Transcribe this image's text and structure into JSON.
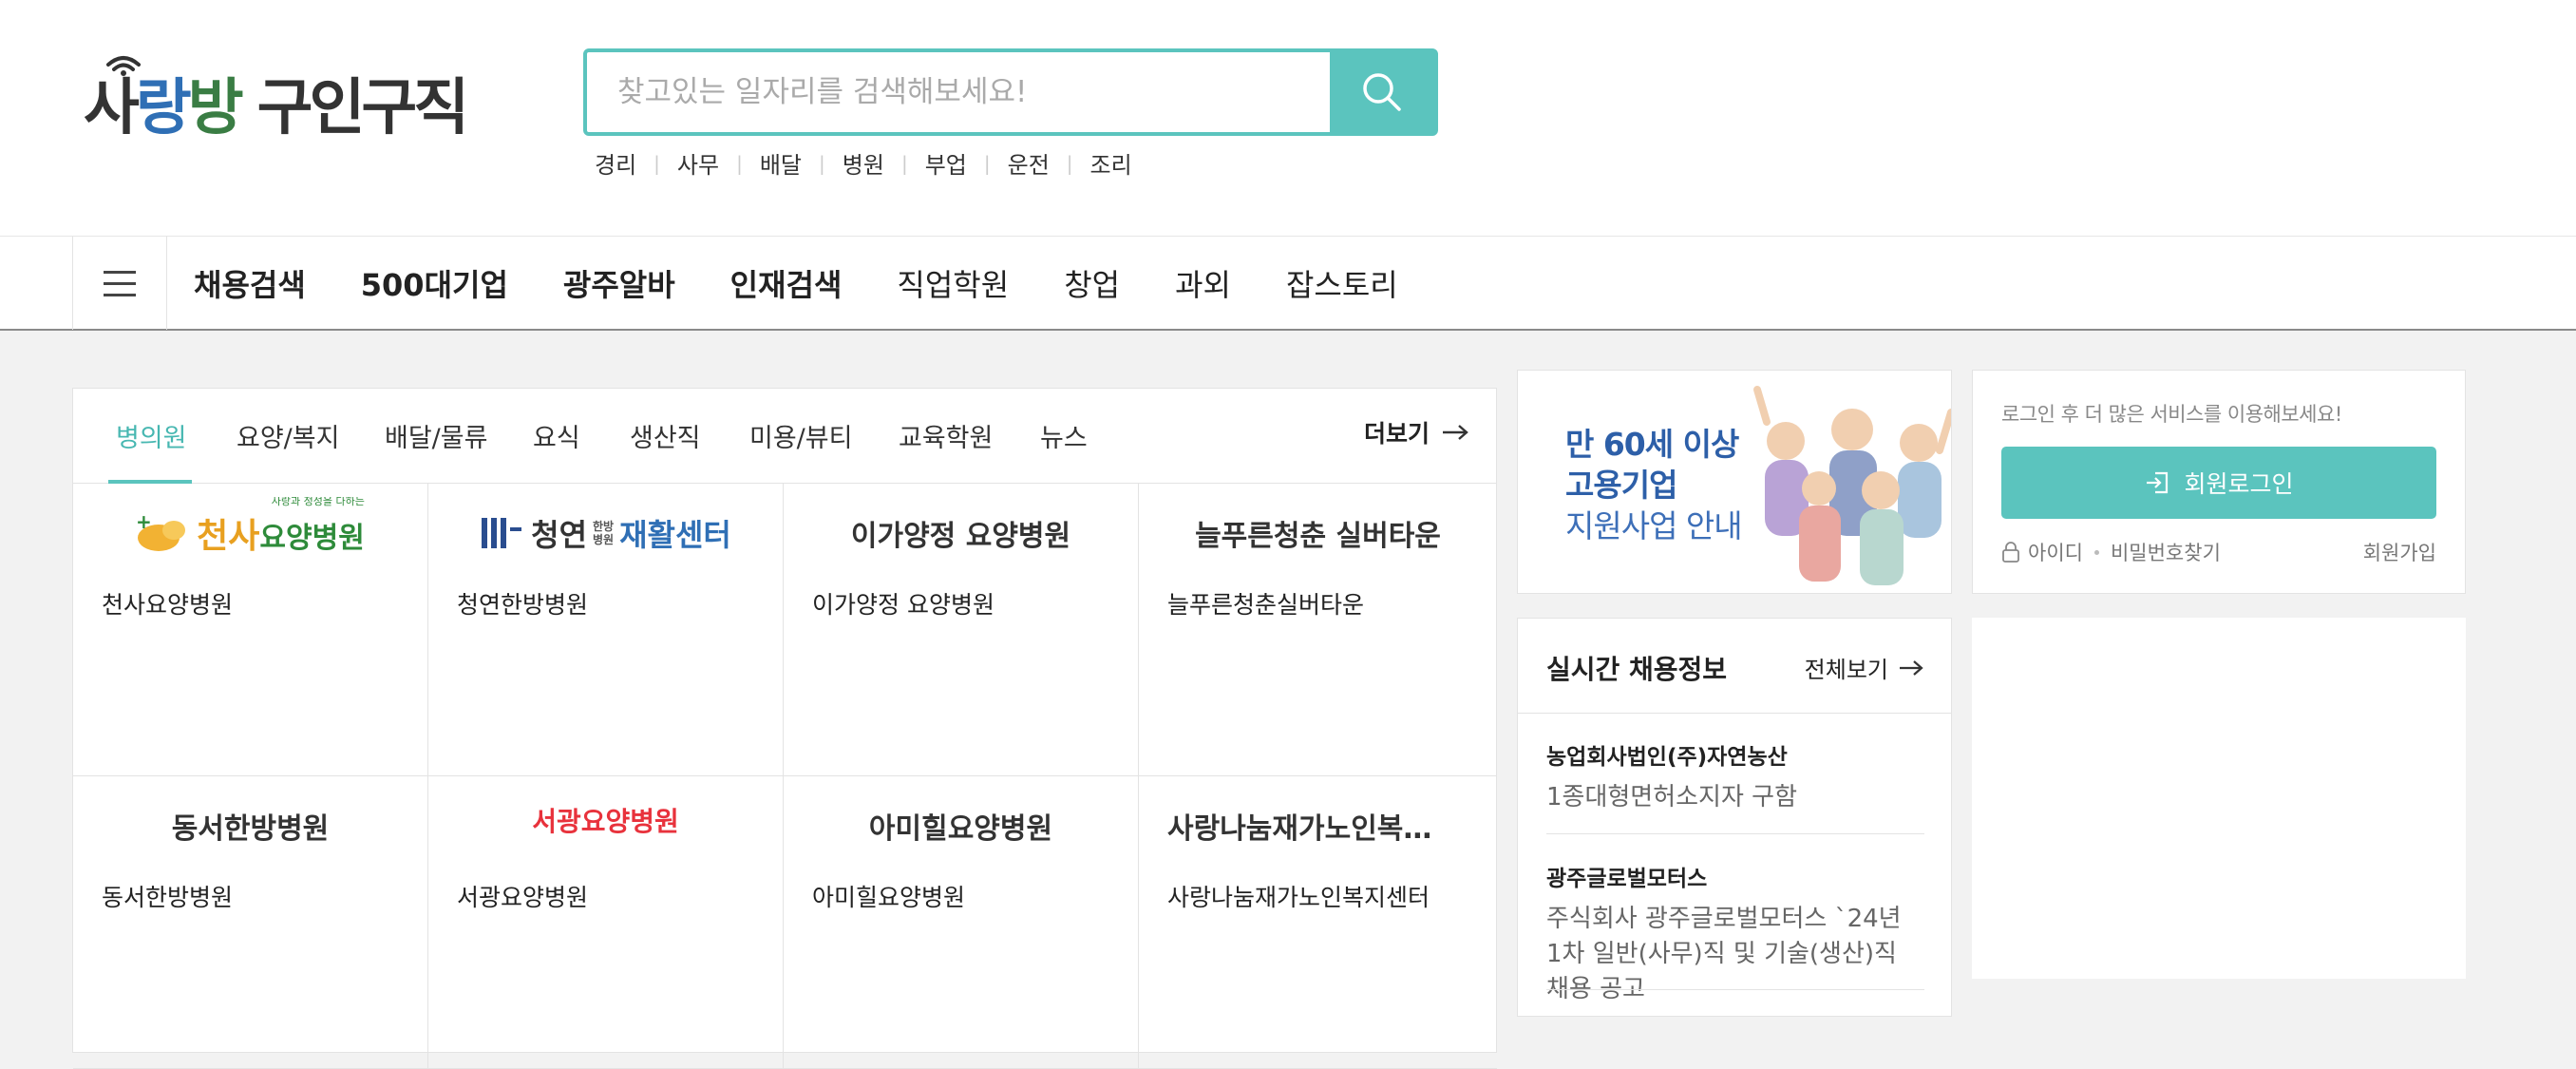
{
  "header": {
    "logo": {
      "part1": "사랑방",
      "part2": "구인구직"
    },
    "search": {
      "placeholder": "찾고있는 일자리를 검색해보세요!"
    },
    "keywords": [
      "경리",
      "사무",
      "배달",
      "병원",
      "부업",
      "운전",
      "조리"
    ]
  },
  "gnb": {
    "items": [
      "채용검색",
      "500대기업",
      "광주알바",
      "인재검색",
      "직업학원",
      "창업",
      "과외",
      "잡스토리"
    ]
  },
  "tabs": {
    "items": [
      "병의원",
      "요양/복지",
      "배달/물류",
      "요식",
      "생산직",
      "미용/뷰티",
      "교육학원",
      "뉴스"
    ],
    "active": "병의원",
    "more": "더보기"
  },
  "companies": [
    {
      "logo_text": "천사요양병원",
      "logo_sub": "사랑과 정성을 다하는",
      "name": "천사요양병원"
    },
    {
      "logo_text_a": "청연",
      "logo_small": "한방\n병원",
      "logo_text_b": "재활센터",
      "name": "청연한방병원"
    },
    {
      "logo_text": "이가양정 요양병원",
      "name": "이가양정 요양병원"
    },
    {
      "logo_text": "늘푸른청춘 실버타운",
      "name": "늘푸른청춘실버타운"
    },
    {
      "logo_text": "동서한방병원",
      "name": "동서한방병원"
    },
    {
      "logo_text": "서광요양병원",
      "name": "서광요양병원"
    },
    {
      "logo_text": "아미힐요양병원",
      "name": "아미힐요양병원"
    },
    {
      "logo_text": "사랑나눔재가노인복…",
      "name": "사랑나눔재가노인복지센터"
    }
  ],
  "banner": {
    "line1": "만 60세 이상",
    "line2": "고용기업",
    "line3": "지원사업 안내"
  },
  "realtime": {
    "title": "실시간 채용정보",
    "view_all": "전체보기",
    "items": [
      {
        "company": "농업회사법인(주)자연농산",
        "title": "1종대형면허소지자 구함"
      },
      {
        "company": "광주글로벌모터스",
        "title": "주식회사 광주글로벌모터스 `24년 1차 일반(사무)직 및 기술(생산)직 채용 공고"
      }
    ]
  },
  "login": {
    "message": "로그인 후 더 많은 서비스를 이용해보세요!",
    "button": "회원로그인",
    "find_id": "아이디",
    "find_pw": "비밀번호찾기",
    "signup": "회원가입"
  },
  "colors": {
    "accent": "#5bc4be",
    "accent_text": "#47b7b1",
    "brand_blue": "#2f6fb5"
  }
}
